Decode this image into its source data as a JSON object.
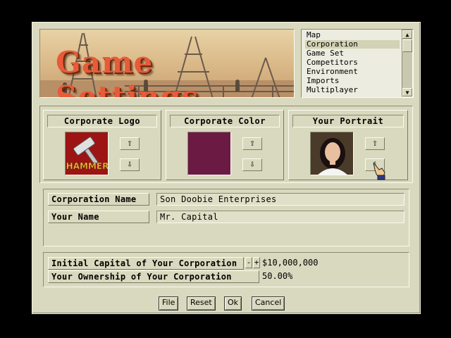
{
  "window": {
    "title": "Game Settings"
  },
  "menu": {
    "items": [
      "Map",
      "Corporation",
      "Game Set",
      "Competitors",
      "Environment",
      "Imports",
      "Multiplayer"
    ],
    "selected": "Corporation"
  },
  "panels": {
    "logo": {
      "label": "Corporate Logo",
      "logo_text": "HAMMER"
    },
    "color": {
      "label": "Corporate Color",
      "swatch": "#6b1a44"
    },
    "portrait": {
      "label": "Your Portrait"
    }
  },
  "fields": {
    "corp_name_label": "Corporation Name",
    "corp_name_value": "Son Doobie Enterprises",
    "your_name_label": "Your Name",
    "your_name_value": "Mr. Capital"
  },
  "finance": {
    "capital_label": "Initial Capital of Your Corporation",
    "capital_value": "$10,000,000",
    "minus": "-",
    "plus": "+",
    "ownership_label": "Your Ownership of Your Corporation",
    "ownership_value": "50.00%"
  },
  "buttons": {
    "file": "File",
    "reset": "Reset",
    "ok": "Ok",
    "cancel": "Cancel"
  },
  "arrows": {
    "up": "⇧",
    "down": "⇩"
  },
  "colors": {
    "dialog_bg": "#d9d9bf",
    "title": "#e85a38",
    "swatch": "#6b1a44",
    "logo_bg": "#9c1414"
  }
}
